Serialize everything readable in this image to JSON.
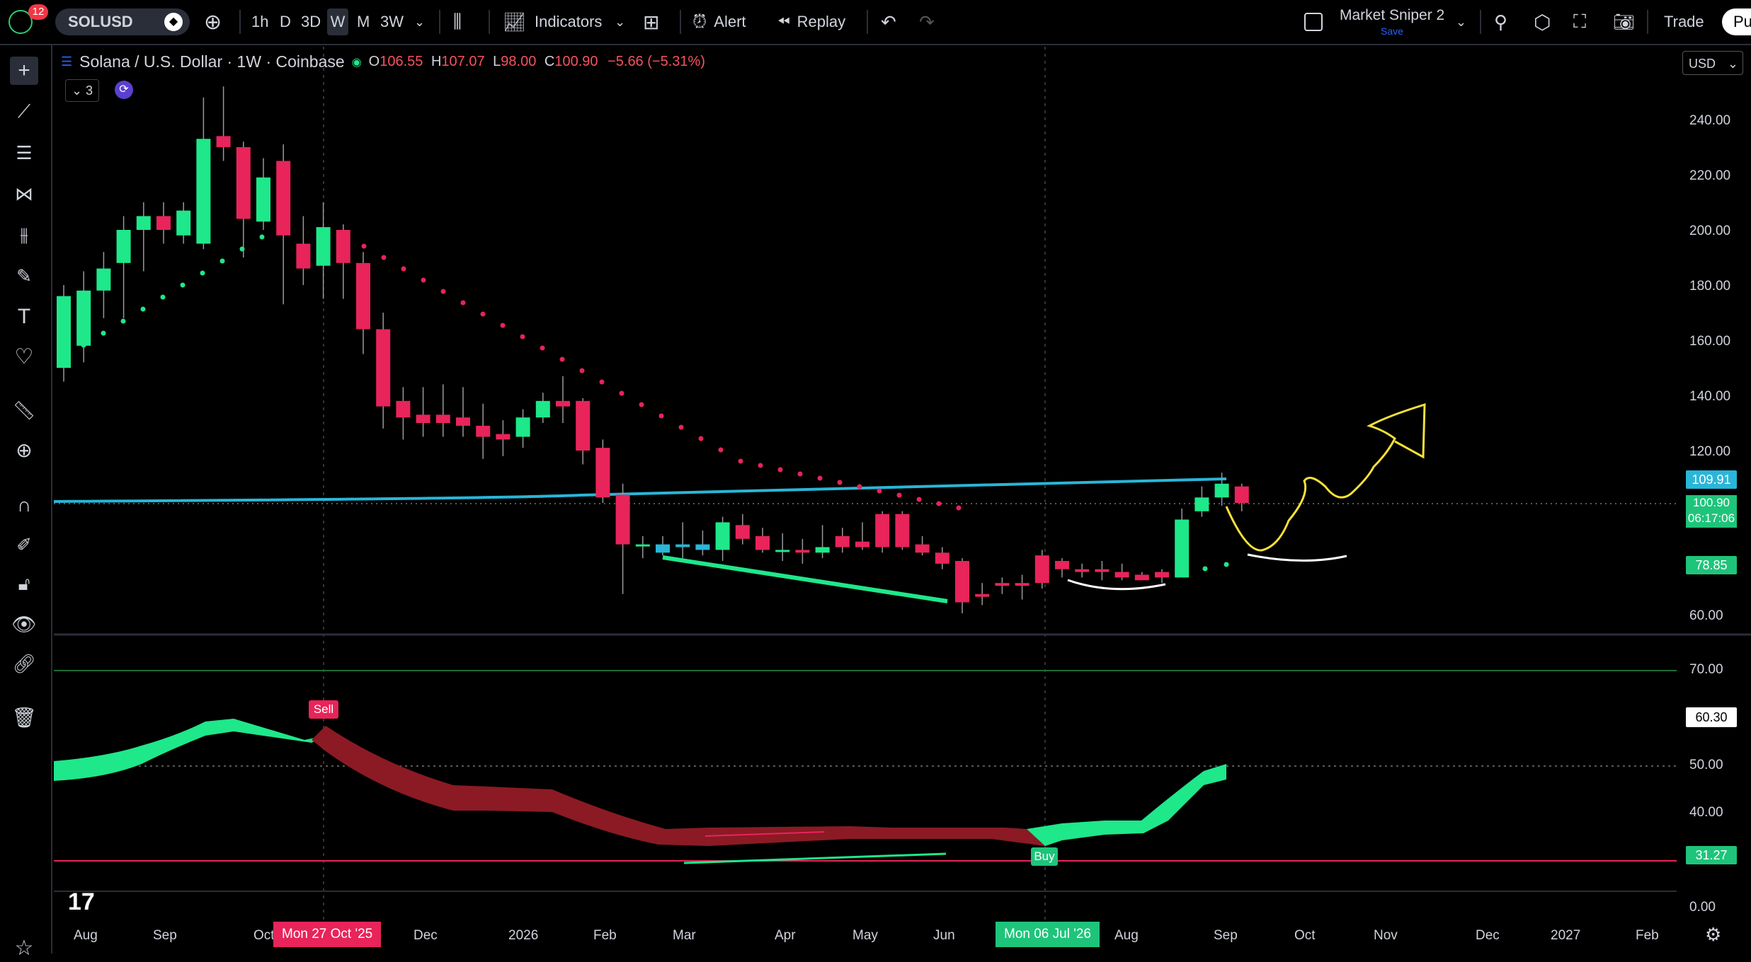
{
  "toolbar": {
    "notifications": "12",
    "symbol": "SOLUSD",
    "intervals": [
      "1h",
      "D",
      "3D",
      "W",
      "M",
      "3W"
    ],
    "active_interval": "W",
    "indicators": "Indicators",
    "alert": "Alert",
    "replay": "Replay",
    "layout_name": "Market Sniper 2",
    "layout_status": "Save",
    "trade": "Trade",
    "publish": "Pu"
  },
  "legend": {
    "title": "Solana / U.S. Dollar · 1W · Coinbase",
    "open_label": "O",
    "open": "106.55",
    "high_label": "H",
    "high": "107.07",
    "low_label": "L",
    "low": "98.00",
    "close_label": "C",
    "close": "100.90",
    "change": "−5.66 (−5.31%)",
    "indicators_count": "3"
  },
  "currency": "USD",
  "price_axis": {
    "ticks": [
      "240.00",
      "220.00",
      "200.00",
      "180.00",
      "160.00",
      "140.00",
      "120.00",
      "60.00"
    ],
    "tag_ma": "109.91",
    "tag_last": "100.90",
    "tag_countdown": "06:17:06",
    "tag_sar": "78.85"
  },
  "osc_axis": {
    "ticks": [
      "70.00",
      "50.00",
      "40.00",
      "0.00"
    ],
    "tag_value": "60.30",
    "tag_low": "31.27"
  },
  "signals": {
    "sell": "Sell",
    "buy": "Buy"
  },
  "time_axis": {
    "labels": [
      "Aug",
      "Sep",
      "Oct",
      "Dec",
      "2026",
      "Feb",
      "Mar",
      "Apr",
      "May",
      "Jun",
      "Aug",
      "Sep",
      "Oct",
      "Nov",
      "Dec",
      "2027",
      "Feb"
    ],
    "cursor_date_1": "Mon 27 Oct '25",
    "cursor_date_2": "Mon 06 Jul '26"
  },
  "colors": {
    "up": "#1ee88a",
    "down": "#e8245a",
    "ma": "#29b6d8",
    "sar_green": "#1ee88a",
    "sar_red": "#e8245a",
    "band_red": "#8b1a24"
  },
  "chart_data": {
    "type": "candlestick",
    "symbol": "SOLUSD",
    "ylim": [
      50,
      250
    ],
    "candles": [
      {
        "o": 150,
        "c": 176,
        "h": 180,
        "l": 145
      },
      {
        "o": 158,
        "c": 178,
        "h": 185,
        "l": 152
      },
      {
        "o": 178,
        "c": 186,
        "h": 192,
        "l": 168
      },
      {
        "o": 188,
        "c": 200,
        "h": 205,
        "l": 168
      },
      {
        "o": 200,
        "c": 205,
        "h": 210,
        "l": 185
      },
      {
        "o": 205,
        "c": 200,
        "h": 210,
        "l": 195
      },
      {
        "o": 198,
        "c": 207,
        "h": 210,
        "l": 195
      },
      {
        "o": 195,
        "c": 233,
        "h": 248,
        "l": 193
      },
      {
        "o": 234,
        "c": 230,
        "h": 252,
        "l": 225
      },
      {
        "o": 230,
        "c": 204,
        "h": 232,
        "l": 190
      },
      {
        "o": 203,
        "c": 219,
        "h": 226,
        "l": 200
      },
      {
        "o": 225,
        "c": 198,
        "h": 231,
        "l": 173
      },
      {
        "o": 195,
        "c": 186,
        "h": 205,
        "l": 180
      },
      {
        "o": 187,
        "c": 201,
        "h": 210,
        "l": 175
      },
      {
        "o": 200,
        "c": 188,
        "h": 202,
        "l": 175
      },
      {
        "o": 188,
        "c": 164,
        "h": 192,
        "l": 155
      },
      {
        "o": 164,
        "c": 136,
        "h": 170,
        "l": 128
      },
      {
        "o": 138,
        "c": 132,
        "h": 143,
        "l": 124
      },
      {
        "o": 133,
        "c": 130,
        "h": 143,
        "l": 125
      },
      {
        "o": 133,
        "c": 130,
        "h": 144,
        "l": 125
      },
      {
        "o": 132,
        "c": 129,
        "h": 143,
        "l": 125
      },
      {
        "o": 129,
        "c": 125,
        "h": 137,
        "l": 117
      },
      {
        "o": 126,
        "c": 124,
        "h": 131,
        "l": 118
      },
      {
        "o": 125,
        "c": 132,
        "h": 135,
        "l": 121
      },
      {
        "o": 132,
        "c": 138,
        "h": 141,
        "l": 130
      },
      {
        "o": 138,
        "c": 136,
        "h": 147,
        "l": 130
      },
      {
        "o": 138,
        "c": 120,
        "h": 139,
        "l": 115
      },
      {
        "o": 121,
        "c": 103,
        "h": 124,
        "l": 101
      },
      {
        "o": 104,
        "c": 86,
        "h": 108,
        "l": 68
      },
      {
        "o": 86,
        "c": 86,
        "h": 89,
        "l": 81
      },
      {
        "o": 83,
        "c": 86,
        "h": 89,
        "l": 82
      },
      {
        "o": 86,
        "c": 85,
        "h": 94,
        "l": 81
      },
      {
        "o": 86,
        "c": 84,
        "h": 91,
        "l": 82
      },
      {
        "o": 84,
        "c": 94,
        "h": 96,
        "l": 80
      },
      {
        "o": 93,
        "c": 88,
        "h": 97,
        "l": 86
      },
      {
        "o": 89,
        "c": 84,
        "h": 92,
        "l": 83
      },
      {
        "o": 84,
        "c": 84,
        "h": 90,
        "l": 80
      },
      {
        "o": 84,
        "c": 83,
        "h": 88,
        "l": 79
      },
      {
        "o": 83,
        "c": 85,
        "h": 93,
        "l": 81
      },
      {
        "o": 89,
        "c": 85,
        "h": 92,
        "l": 83
      },
      {
        "o": 87,
        "c": 85,
        "h": 94,
        "l": 84
      },
      {
        "o": 97,
        "c": 85,
        "h": 98,
        "l": 83
      },
      {
        "o": 97,
        "c": 85,
        "h": 98,
        "l": 84
      },
      {
        "o": 86,
        "c": 83,
        "h": 89,
        "l": 82
      },
      {
        "o": 83,
        "c": 79,
        "h": 85,
        "l": 77
      },
      {
        "o": 80,
        "c": 65,
        "h": 81,
        "l": 61
      },
      {
        "o": 68,
        "c": 67,
        "h": 72,
        "l": 64
      },
      {
        "o": 72,
        "c": 71,
        "h": 74,
        "l": 68
      },
      {
        "o": 72,
        "c": 71,
        "h": 75,
        "l": 66
      },
      {
        "o": 82,
        "c": 72,
        "h": 84,
        "l": 70
      },
      {
        "o": 80,
        "c": 77,
        "h": 81,
        "l": 74
      },
      {
        "o": 77,
        "c": 76,
        "h": 79,
        "l": 74
      },
      {
        "o": 77,
        "c": 76,
        "h": 80,
        "l": 73
      },
      {
        "o": 76,
        "c": 74,
        "h": 79,
        "l": 73
      },
      {
        "o": 75,
        "c": 73,
        "h": 76,
        "l": 73
      },
      {
        "o": 76,
        "c": 74,
        "h": 77,
        "l": 72
      },
      {
        "o": 74,
        "c": 95,
        "h": 99,
        "l": 74
      },
      {
        "o": 98,
        "c": 103,
        "h": 107,
        "l": 96
      },
      {
        "o": 103,
        "c": 108,
        "h": 112,
        "l": 100
      },
      {
        "o": 107,
        "c": 101,
        "h": 108,
        "l": 98
      }
    ]
  }
}
